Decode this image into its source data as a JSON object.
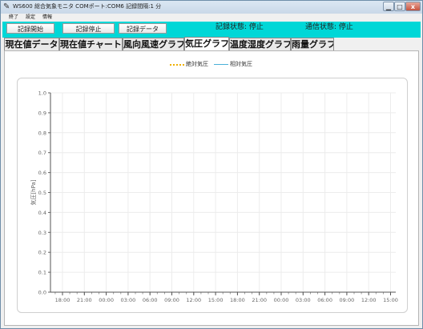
{
  "window": {
    "title": "WS600 総合気象モニタ COMポート:COM6 記録間隔:1 分",
    "app_icon": "app-icon",
    "min_glyph": "▁",
    "max_glyph": "□",
    "close_glyph": "x"
  },
  "menu": {
    "items": [
      {
        "label": "終了"
      },
      {
        "label": "設定"
      },
      {
        "label": "情報"
      }
    ]
  },
  "toolbar": {
    "start_label": "記録開始",
    "stop_label": "記録停止",
    "data_label": "記録データ",
    "record_status": "記録状態:  停止",
    "comm_status": "通信状態:  停止",
    "accent_color": "#00d7d7"
  },
  "tabs": [
    {
      "label": "現在値データ",
      "active": false
    },
    {
      "label": "現在値チャート",
      "active": false
    },
    {
      "label": "風向風速グラフ",
      "active": false
    },
    {
      "label": "気圧グラフ",
      "active": true
    },
    {
      "label": "温度湿度グラフ",
      "active": false
    },
    {
      "label": "雨量グラフ",
      "active": false
    }
  ],
  "chart_data": {
    "type": "line",
    "title": "",
    "xlabel": "",
    "ylabel": "気圧[hPa]",
    "ylim": [
      0,
      1
    ],
    "yticks": [
      "0.0",
      "0.1",
      "0.2",
      "0.3",
      "0.4",
      "0.5",
      "0.6",
      "0.7",
      "0.8",
      "0.9",
      "1.0"
    ],
    "categories": [
      "18:00",
      "21:00",
      "00:00",
      "03:00",
      "06:00",
      "09:00",
      "12:00",
      "15:00",
      "18:00",
      "21:00",
      "00:00",
      "03:00",
      "06:00",
      "09:00",
      "12:00",
      "15:00"
    ],
    "grid": true,
    "legend_position": "top-center",
    "series": [
      {
        "name": "絶対気圧",
        "values": [],
        "color": "#f0b000",
        "style": "dotted"
      },
      {
        "name": "相対気圧",
        "values": [],
        "color": "#4ab0d8",
        "style": "solid"
      }
    ]
  }
}
